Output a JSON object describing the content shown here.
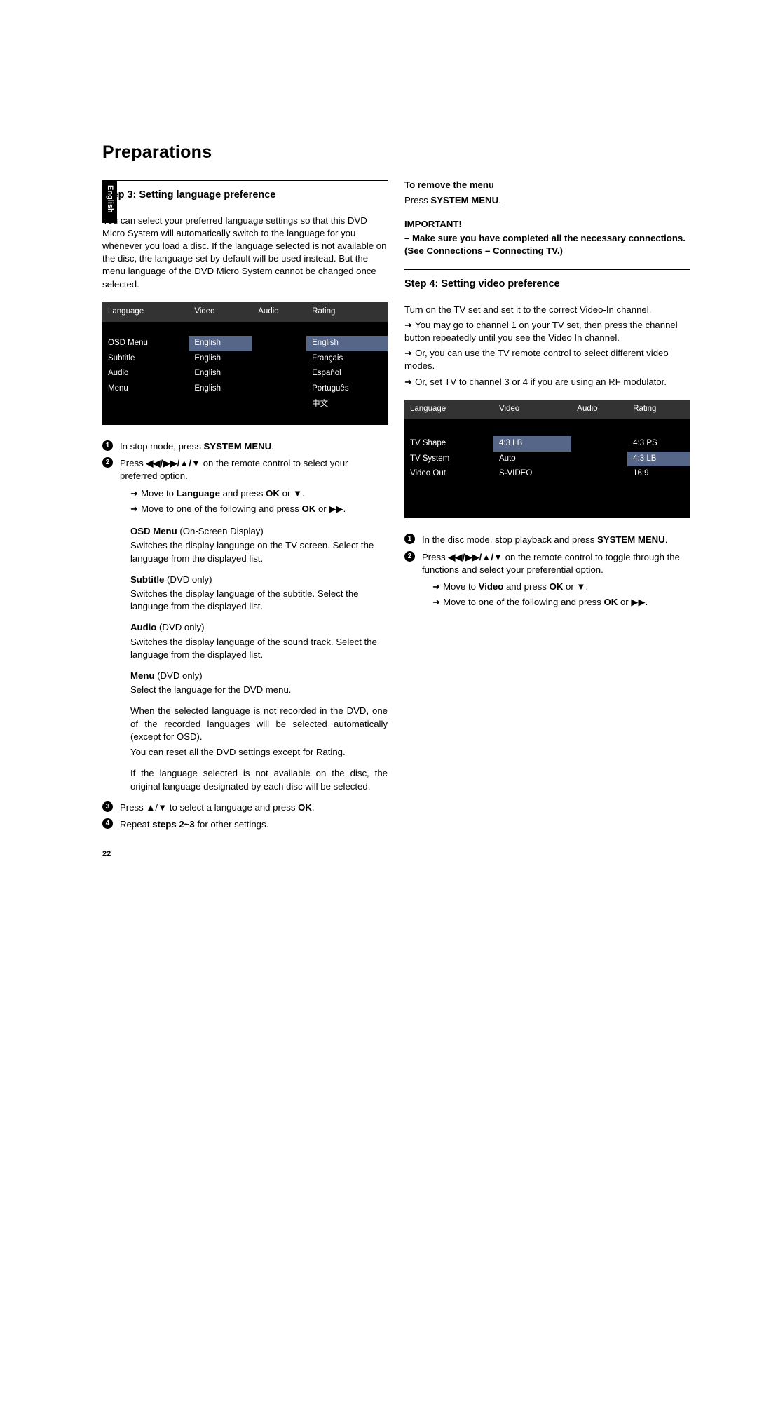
{
  "title": "Preparations",
  "tab": "English",
  "left": {
    "step": "Step 3:   Setting language preference",
    "intro": "You can select your preferred language settings so that this DVD Micro System will automatically switch to the language for you whenever you load a disc. If the language selected is not available on the disc, the language set by default will be used instead. But the menu language of the DVD Micro System cannot be changed once selected.",
    "osd": {
      "tabs": [
        "Language",
        "Video",
        "Audio",
        "Rating"
      ],
      "rows": [
        [
          "OSD Menu",
          "English",
          "",
          "English"
        ],
        [
          "Subtitle",
          "English",
          "",
          "Français"
        ],
        [
          "Audio",
          "English",
          "",
          "Español"
        ],
        [
          "Menu",
          "English",
          "",
          "Português"
        ],
        [
          "",
          "",
          "",
          "中文"
        ]
      ]
    },
    "s1": "In stop mode, press ",
    "s1b": "SYSTEM MENU",
    "s2a": "Press ",
    "s2b": "◀◀/▶▶/▲/▼",
    "s2c": " on the remote control to select your preferred option.",
    "arr1a": "Move to ",
    "arr1b": "Language",
    "arr1c": " and press ",
    "arr1d": "OK",
    "arr1e": " or  ▼.",
    "arr2a": "Move to one of the following and press ",
    "arr2b": "OK",
    "arr2c": " or  ▶▶.",
    "osdmenu_t": "OSD Menu ",
    "osdmenu_h": "(On-Screen Display)",
    "osdmenu_b": "Switches the display language on the TV screen. Select the language from the displayed list.",
    "subtitle_t": "Subtitle ",
    "subtitle_h": "(DVD only)",
    "subtitle_b": "Switches the display language of the subtitle. Select the language from the displayed list.",
    "audio_t": "Audio ",
    "audio_h": "(DVD only)",
    "audio_b": "Switches the display language of the sound track. Select the language from the displayed list.",
    "menu_t": "Menu ",
    "menu_h": "(DVD only)",
    "menu_b": "Select the language for the DVD menu.",
    "note1": " When the selected language is not recorded in the DVD, one of the recorded languages will be selected automatically (except for OSD).",
    "note2": "You can reset all the DVD settings except for Rating.",
    "note3": "If the language selected is not available on the disc, the original language designated by each disc will be selected.",
    "s3a": "Press ▲/▼ to select a language and press ",
    "s3b": "OK",
    "s4a": "Repeat ",
    "s4b": "steps 2~3",
    "s4c": " for other settings."
  },
  "right": {
    "remove_t": "To remove the menu",
    "remove_b1": "Press ",
    "remove_b2": "SYSTEM MENU",
    "imp_t": "IMPORTANT!",
    "imp_b": "–  Make sure you have completed all the necessary connections. (See Connections – Connecting TV.)",
    "step": "Step 4:   Setting video preference",
    "p1": "Turn on the TV set and set it to the correct Video-In channel.",
    "a1": "You may go to channel 1 on your TV set, then press the channel button repeatedly until you see the Video In channel.",
    "a2": "Or, you can use the TV remote control to select different video modes.",
    "a3": "Or, set TV to channel 3 or 4 if you are using an RF modulator.",
    "osd": {
      "tabs": [
        "Language",
        "Video",
        "Audio",
        "Rating"
      ],
      "rows": [
        [
          "TV Shape",
          "4:3 LB",
          "",
          "4:3 PS"
        ],
        [
          "TV System",
          "Auto",
          "",
          "4:3 LB"
        ],
        [
          "Video Out",
          "S-VIDEO",
          "",
          "16:9"
        ]
      ]
    },
    "s1": "In the disc mode, stop playback and press ",
    "s1b": "SYSTEM MENU",
    "s2a": "Press ",
    "s2b": "◀◀/▶▶/▲/▼",
    "s2c": " on the remote control to toggle through the functions and select your preferential option.",
    "arr1a": "Move to ",
    "arr1b": "Video",
    "arr1c": " and press ",
    "arr1d": "OK",
    "arr1e": " or ▼.",
    "arr2a": "Move to one of the following and press ",
    "arr2b": "OK",
    "arr2c": " or  ▶▶."
  },
  "pagenum": "22"
}
